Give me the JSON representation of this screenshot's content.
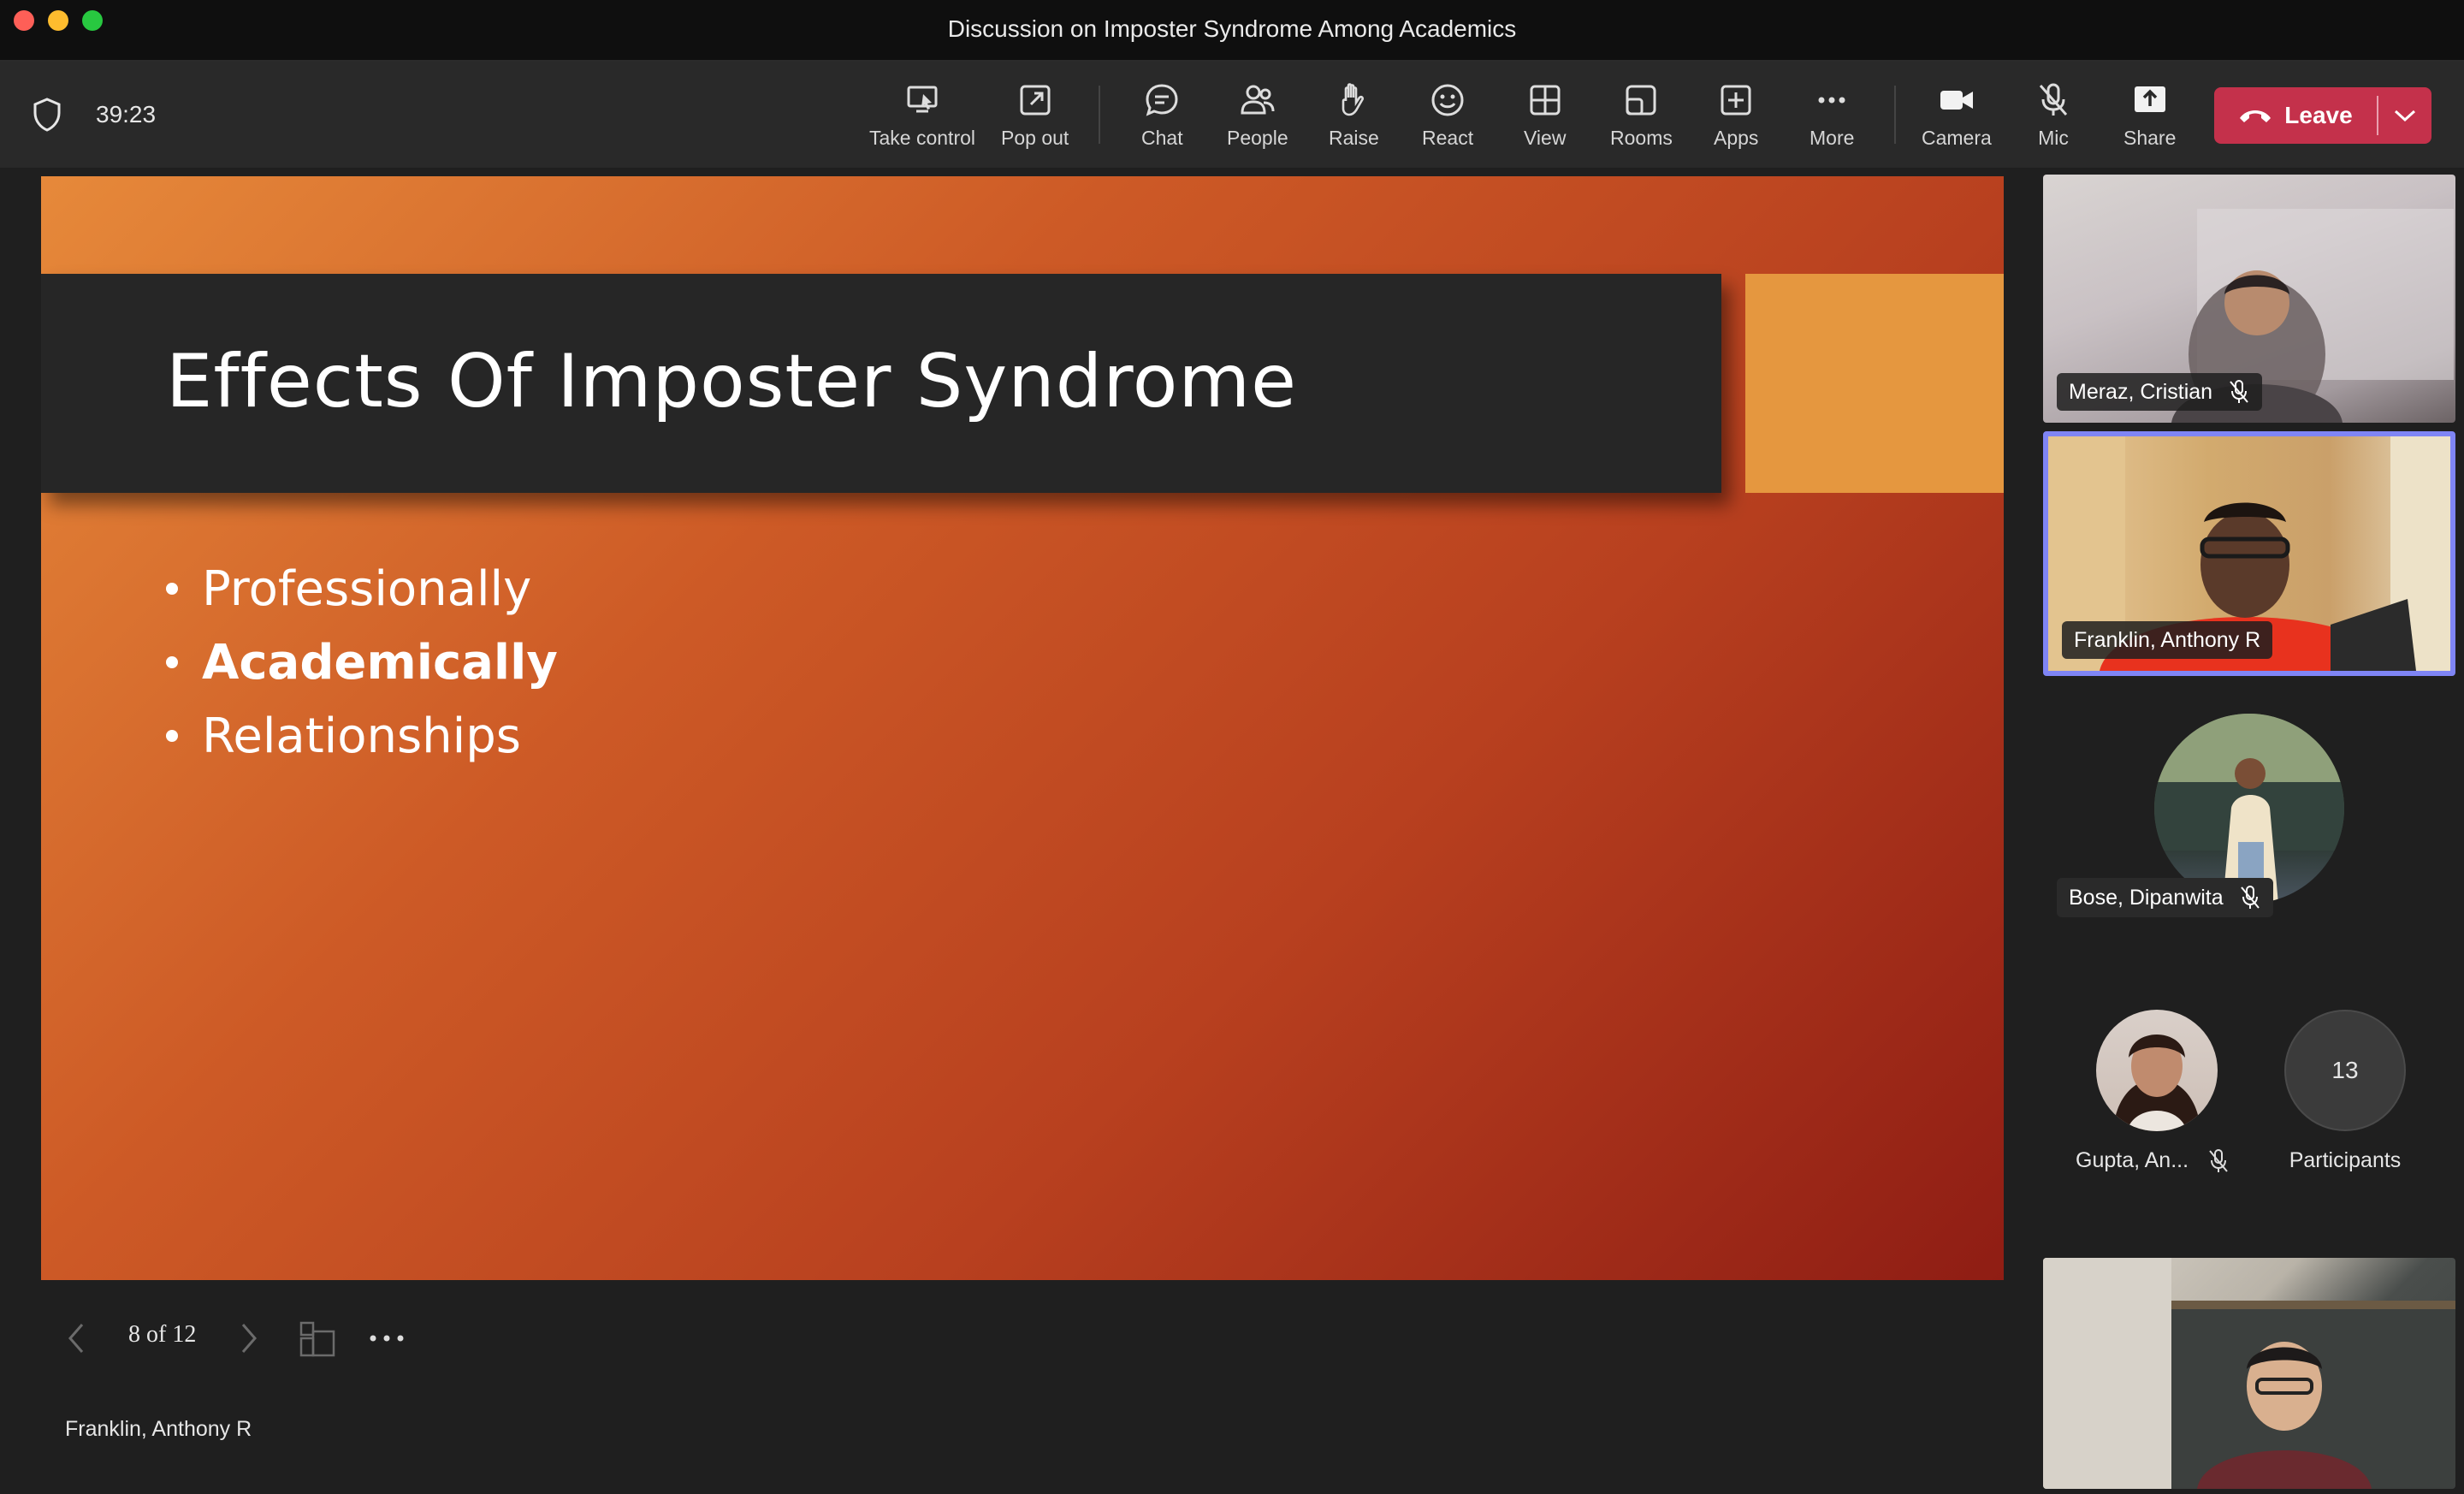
{
  "window": {
    "title": "Discussion on Imposter Syndrome Among Academics"
  },
  "toolbar": {
    "timer": "39:23",
    "tools": [
      {
        "id": "take-control",
        "label": "Take control",
        "icon": "take-control-icon"
      },
      {
        "id": "pop-out",
        "label": "Pop out",
        "icon": "pop-out-icon"
      },
      {
        "id": "chat",
        "label": "Chat",
        "icon": "chat-icon"
      },
      {
        "id": "people",
        "label": "People",
        "icon": "people-icon"
      },
      {
        "id": "raise",
        "label": "Raise",
        "icon": "raise-hand-icon"
      },
      {
        "id": "react",
        "label": "React",
        "icon": "react-icon"
      },
      {
        "id": "view",
        "label": "View",
        "icon": "view-grid-icon"
      },
      {
        "id": "rooms",
        "label": "Rooms",
        "icon": "rooms-icon"
      },
      {
        "id": "apps",
        "label": "Apps",
        "icon": "apps-icon"
      },
      {
        "id": "more",
        "label": "More",
        "icon": "more-icon"
      },
      {
        "id": "camera",
        "label": "Camera",
        "icon": "camera-icon"
      },
      {
        "id": "mic",
        "label": "Mic",
        "icon": "mic-off-icon"
      },
      {
        "id": "share",
        "label": "Share",
        "icon": "share-icon"
      }
    ],
    "leave_label": "Leave",
    "leave_color": "#c4314b"
  },
  "slide": {
    "title": "Effects Of Imposter Syndrome",
    "bullets": [
      "Professionally",
      "Academically",
      "Relationships"
    ],
    "pager": "8 of 12",
    "presenter": "Franklin, Anthony R"
  },
  "participants": {
    "tile1_name": "Meraz, Cristian",
    "tile2_name": "Franklin, Anthony R",
    "tile3_name": "Bose, Dipanwita",
    "tile4_name": "Gupta, An...",
    "count": "13",
    "count_label": "Participants",
    "active_speaker_color": "#7f85f5"
  }
}
